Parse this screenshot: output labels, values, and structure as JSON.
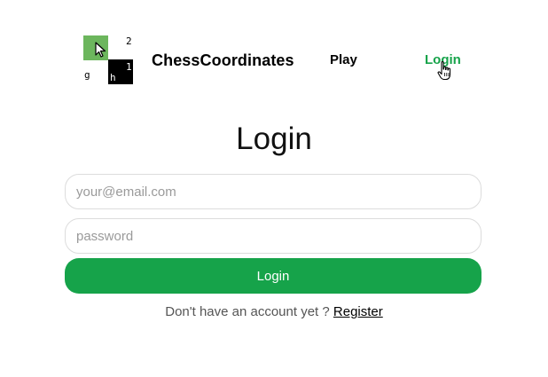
{
  "header": {
    "logo": {
      "chars": {
        "top_right": "2",
        "center_right": "1",
        "bottom_left": "g",
        "bottom_center": "h"
      },
      "colors": {
        "green": "#6cb65d",
        "black": "#000000"
      }
    },
    "brand": "ChessCoordinates",
    "nav": {
      "play": "Play",
      "login": "Login"
    },
    "active_color": "#16a34a"
  },
  "main": {
    "title": "Login",
    "email": {
      "placeholder": "your@email.com",
      "value": ""
    },
    "password": {
      "placeholder": "password",
      "value": ""
    },
    "submit_label": "Login",
    "footer": {
      "prompt": "Don't have an account yet ?",
      "register_link": "Register"
    }
  }
}
